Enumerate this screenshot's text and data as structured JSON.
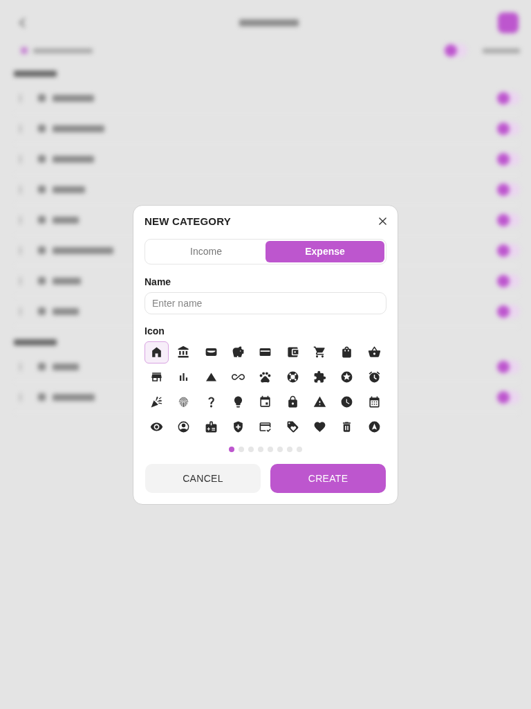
{
  "dialog": {
    "title": "NEW CATEGORY",
    "type_tabs": [
      {
        "label": "Income",
        "selected": false
      },
      {
        "label": "Expense",
        "selected": true
      }
    ],
    "name_field": {
      "label": "Name",
      "placeholder": "Enter name"
    },
    "icon_picker": {
      "label": "Icon",
      "icons": [
        {
          "selected": true
        },
        {
          "selected": false
        },
        {
          "selected": false
        },
        {
          "selected": false
        },
        {
          "selected": false
        },
        {
          "selected": false
        },
        {
          "selected": false
        },
        {
          "selected": false
        },
        {
          "selected": false
        },
        {
          "selected": false
        },
        {
          "selected": false
        },
        {
          "selected": false
        },
        {
          "selected": false
        },
        {
          "selected": false
        },
        {
          "selected": false
        },
        {
          "selected": false
        },
        {
          "selected": false
        },
        {
          "selected": false
        },
        {
          "selected": false
        },
        {
          "selected": false
        },
        {
          "selected": false
        },
        {
          "selected": false
        },
        {
          "selected": false
        },
        {
          "selected": false
        },
        {
          "selected": false
        },
        {
          "selected": false
        },
        {
          "selected": false
        },
        {
          "selected": false
        },
        {
          "selected": false
        },
        {
          "selected": false
        },
        {
          "selected": false
        },
        {
          "selected": false
        },
        {
          "selected": false
        },
        {
          "selected": false
        },
        {
          "selected": false
        },
        {
          "selected": false
        }
      ],
      "pages": [
        {
          "selected": true
        },
        {
          "selected": false
        },
        {
          "selected": false
        },
        {
          "selected": false
        },
        {
          "selected": false
        },
        {
          "selected": false
        },
        {
          "selected": false
        },
        {
          "selected": false
        }
      ]
    },
    "buttons": [
      {
        "label": "CANCEL",
        "kind": "secondary"
      },
      {
        "label": "CREATE",
        "kind": "primary"
      }
    ]
  }
}
